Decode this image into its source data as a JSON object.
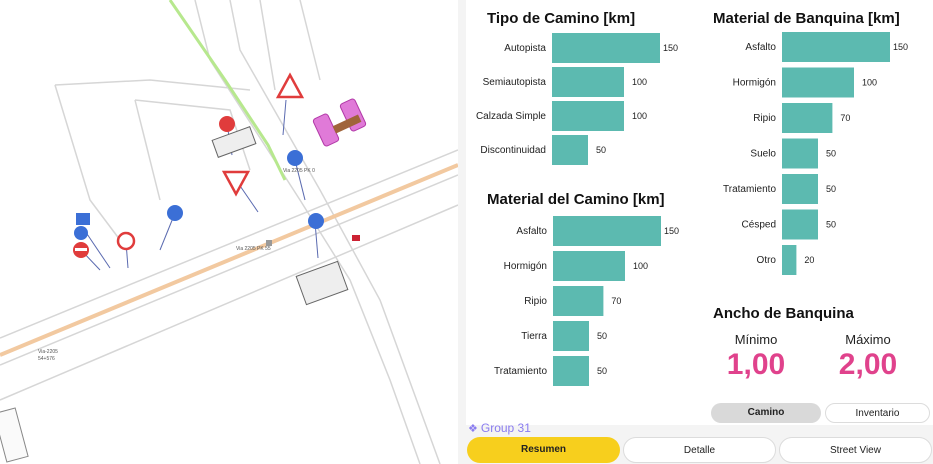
{
  "map": {
    "road_labels": [
      "Via 2205 PK 55",
      "Via 2205 PK 0",
      "Via 2205",
      "Via-2205",
      "54+576"
    ]
  },
  "charts": {
    "tipo_camino": {
      "title": "Tipo de Camino [km]",
      "categories": [
        "Autopista",
        "Semiautopista",
        "Calzada Simple",
        "Discontinuidad"
      ],
      "values": [
        150,
        100,
        100,
        50
      ]
    },
    "material_camino": {
      "title": "Material del Camino [km]",
      "categories": [
        "Asfalto",
        "Hormigón",
        "Ripio",
        "Tierra",
        "Tratamiento"
      ],
      "values": [
        150,
        100,
        70,
        50,
        50
      ]
    },
    "material_banquina": {
      "title": "Material de Banquina [km]",
      "categories": [
        "Asfalto",
        "Hormigón",
        "Ripio",
        "Suelo",
        "Tratamiento",
        "Césped",
        "Otro"
      ],
      "values": [
        150,
        100,
        70,
        50,
        50,
        50,
        20
      ]
    }
  },
  "chart_data": [
    {
      "type": "bar",
      "title": "Tipo de Camino [km]",
      "categories": [
        "Autopista",
        "Semiautopista",
        "Calzada Simple",
        "Discontinuidad"
      ],
      "values": [
        150,
        100,
        100,
        50
      ]
    },
    {
      "type": "bar",
      "title": "Material del Camino [km]",
      "categories": [
        "Asfalto",
        "Hormigón",
        "Ripio",
        "Tierra",
        "Tratamiento"
      ],
      "values": [
        150,
        100,
        70,
        50,
        50
      ]
    },
    {
      "type": "bar",
      "title": "Material de Banquina [km]",
      "categories": [
        "Asfalto",
        "Hormigón",
        "Ripio",
        "Suelo",
        "Tratamiento",
        "Césped",
        "Otro"
      ],
      "values": [
        150,
        100,
        70,
        50,
        50,
        50,
        20
      ]
    }
  ],
  "ancho_banquina": {
    "title": "Ancho de Banquina",
    "min_label": "Mínimo",
    "max_label": "Máximo",
    "min_value": "1,00",
    "max_value": "2,00"
  },
  "toggle": {
    "camino": "Camino",
    "inventario": "Inventario"
  },
  "group_tag": "Group 31",
  "tabs": {
    "resumen": "Resumen",
    "detalle": "Detalle",
    "street_view": "Street View"
  },
  "colors": {
    "bar": "#5cbab0",
    "accent_value": "#e0428c",
    "active_tab": "#f7cf1d",
    "group_tag": "#8a7cf0"
  },
  "icons": [
    "diamond-group-icon",
    "stop-sign-icon",
    "yield-sign-icon",
    "warning-sign-icon",
    "blue-direction-sign-icon",
    "bridge-icon"
  ]
}
